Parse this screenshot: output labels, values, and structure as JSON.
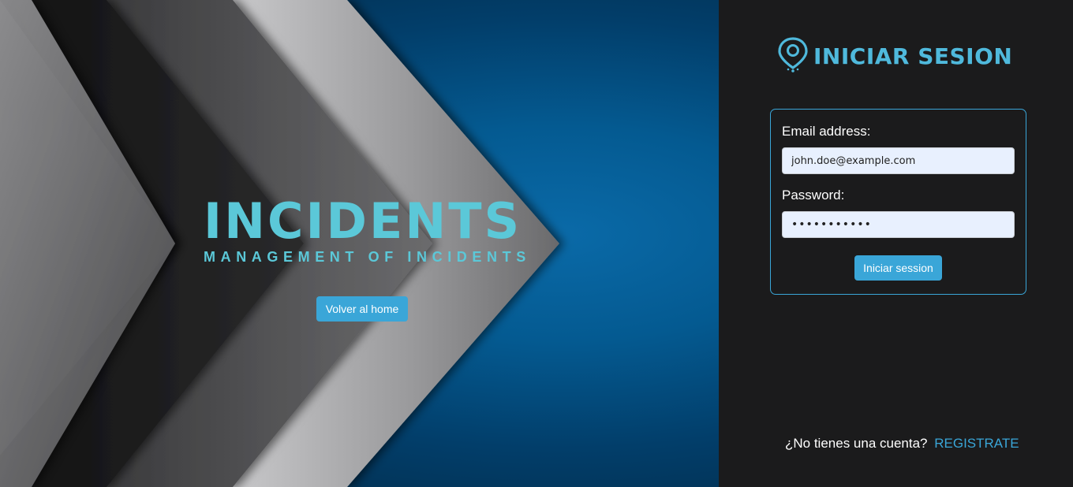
{
  "hero": {
    "brand_title": "INCIDENTS",
    "brand_subtitle": "MANAGEMENT OF INCIDENTS",
    "home_button_label": "Volver al home"
  },
  "login": {
    "title": "INICIAR SESION",
    "logo_icon": "map-pin-icon",
    "email_label": "Email address:",
    "email_value": "john.doe@example.com",
    "password_label": "Password:",
    "password_value": "•••••••••••",
    "submit_label": "Iniciar session"
  },
  "register": {
    "prompt": "¿No tienes una cuenta?",
    "link_label": "REGISTRATE"
  },
  "colors": {
    "accent": "#3aa6d8",
    "brand": "#5bc8d8",
    "panel_bg": "#1b1b1c",
    "hero_blue": "#045a91"
  }
}
